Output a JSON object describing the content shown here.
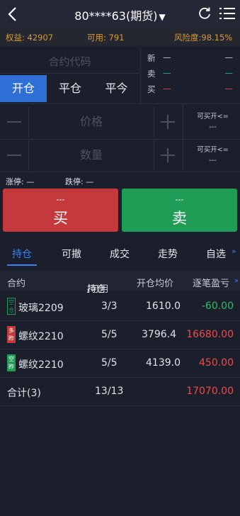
{
  "header": {
    "title": "80****63(期货)",
    "caret": "▼"
  },
  "account": {
    "equity": "权益: 42907",
    "available": "可用: 791",
    "risk": "风险度:98.15%"
  },
  "form": {
    "code_placeholder": "合约代码",
    "tabs": [
      "开仓",
      "平仓",
      "平今"
    ],
    "price_placeholder": "价格",
    "qty_placeholder": "数量",
    "buy_avail_label_1": "可买开<=",
    "buy_avail_value_1": "---",
    "buy_avail_label_2": "可买开<=",
    "buy_avail_value_2": "---",
    "limit_up": "涨停: —",
    "limit_down": "跌停: —"
  },
  "quote": {
    "rows": [
      {
        "label": "新",
        "v1": "—",
        "v2": "—",
        "color": "#c9ccd6"
      },
      {
        "label": "卖",
        "v1": "—",
        "v2": "—",
        "color": "#2bbf6a"
      },
      {
        "label": "买",
        "v1": "—",
        "v2": "—",
        "color": "#ef4b4b"
      }
    ]
  },
  "actions": {
    "buy_price": "---",
    "buy_label": "买",
    "sell_price": "---",
    "sell_label": "卖"
  },
  "tabs": [
    "持仓",
    "可撤",
    "成交",
    "走势",
    "自选"
  ],
  "more": "»",
  "table": {
    "headers": {
      "contract": "合约",
      "hold": "持仓",
      "avail": "/可用",
      "avg_price": "开仓均价",
      "pnl": "逐笔盈亏",
      "arrow": "»"
    },
    "rows": [
      {
        "badge": "空仓",
        "badge_style": "green",
        "name": "玻璃2209",
        "qty": "3/3",
        "avg": "1610.0",
        "pnl": "-60.00",
        "pnl_sign": "neg"
      },
      {
        "badge": "多昨",
        "badge_style": "red",
        "name": "螺纹2210",
        "qty": "5/5",
        "avg": "3796.4",
        "pnl": "16680.00",
        "pnl_sign": "pos"
      },
      {
        "badge": "空昨",
        "badge_style": "greenfill",
        "name": "螺纹2210",
        "qty": "5/5",
        "avg": "4139.0",
        "pnl": "450.00",
        "pnl_sign": "pos"
      }
    ],
    "total": {
      "label": "合计(3)",
      "qty": "13/13",
      "pnl": "17070.00"
    }
  },
  "colors": {
    "accent": "#3b82f0",
    "buy": "#c3393c",
    "sell": "#1f9d57",
    "account_text": "#d79a3c"
  }
}
